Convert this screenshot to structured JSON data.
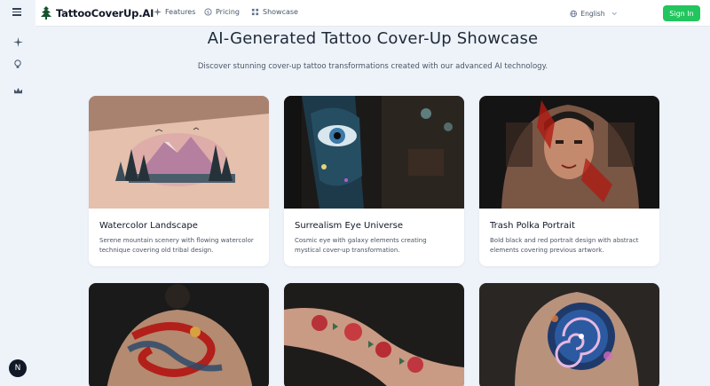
{
  "header": {
    "brand": "TattooCoverUp.AI",
    "nav": [
      {
        "label": "Features",
        "icon": "sparkle-icon"
      },
      {
        "label": "Pricing",
        "icon": "dollar-icon"
      },
      {
        "label": "Showcase",
        "icon": "grid-icon"
      }
    ],
    "language": "English",
    "signin": "Sign In"
  },
  "page": {
    "title": "AI-Generated Tattoo Cover-Up Showcase",
    "subtitle": "Discover stunning cover-up tattoo transformations created with our advanced AI technology."
  },
  "cards": [
    {
      "title": "Watercolor Landscape",
      "desc": "Serene mountain scenery with flowing watercolor technique covering old tribal design."
    },
    {
      "title": "Surrealism Eye Universe",
      "desc": "Cosmic eye with galaxy elements creating mystical cover-up transformation."
    },
    {
      "title": "Trash Polka Portrait",
      "desc": "Bold black and red portrait design with abstract elements covering previous artwork."
    }
  ],
  "colors": {
    "accent": "#22c55e",
    "background": "#eef3fa"
  },
  "sidebar_icons": [
    "sparkle-icon",
    "lightbulb-icon",
    "crown-icon"
  ],
  "avatar": "N"
}
